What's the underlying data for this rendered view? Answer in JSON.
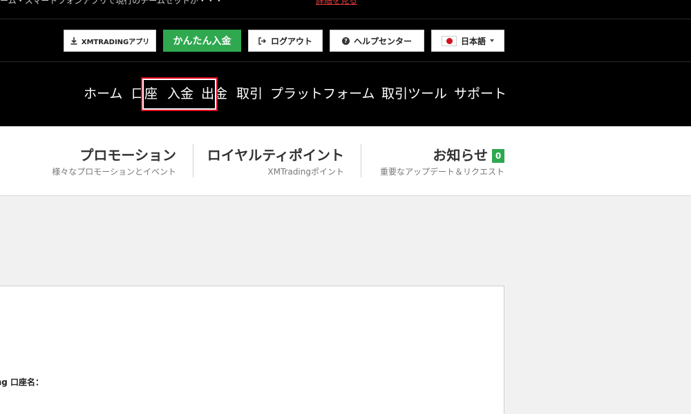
{
  "topstrip": {
    "text": "ーム・スマートフォンアプリで現行のチームセットが・・・",
    "link": "詳細を見る"
  },
  "toolbar": {
    "app_label": "XMTRADINGアプリ",
    "deposit_label": "かんたん入金",
    "logout_label": "ログアウト",
    "help_label": "ヘルプセンター",
    "language_label": "日本語",
    "icons": {
      "app": "download-icon",
      "logout": "logout-icon",
      "help": "question-icon",
      "language": "japan-flag-icon"
    }
  },
  "nav": {
    "items": [
      "ホーム",
      "口座",
      "入金",
      "出金",
      "取引",
      "プラットフォーム",
      "取引ツール",
      "サポート"
    ],
    "highlighted": "入金"
  },
  "subnav": {
    "promotions": {
      "title": "プロモーション",
      "desc": "様々なプロモーションとイベント"
    },
    "loyalty": {
      "title": "ロイヤルティポイント",
      "desc": "XMTradingポイント"
    },
    "news": {
      "title": "お知らせ",
      "badge": "0",
      "desc": "重要なアップデート＆リクエスト"
    }
  },
  "content": {
    "account_label": "ding 口座名："
  },
  "colors": {
    "accent_green": "#2fa84f",
    "highlight_red": "#e3001b",
    "nav_bg": "#000000"
  }
}
